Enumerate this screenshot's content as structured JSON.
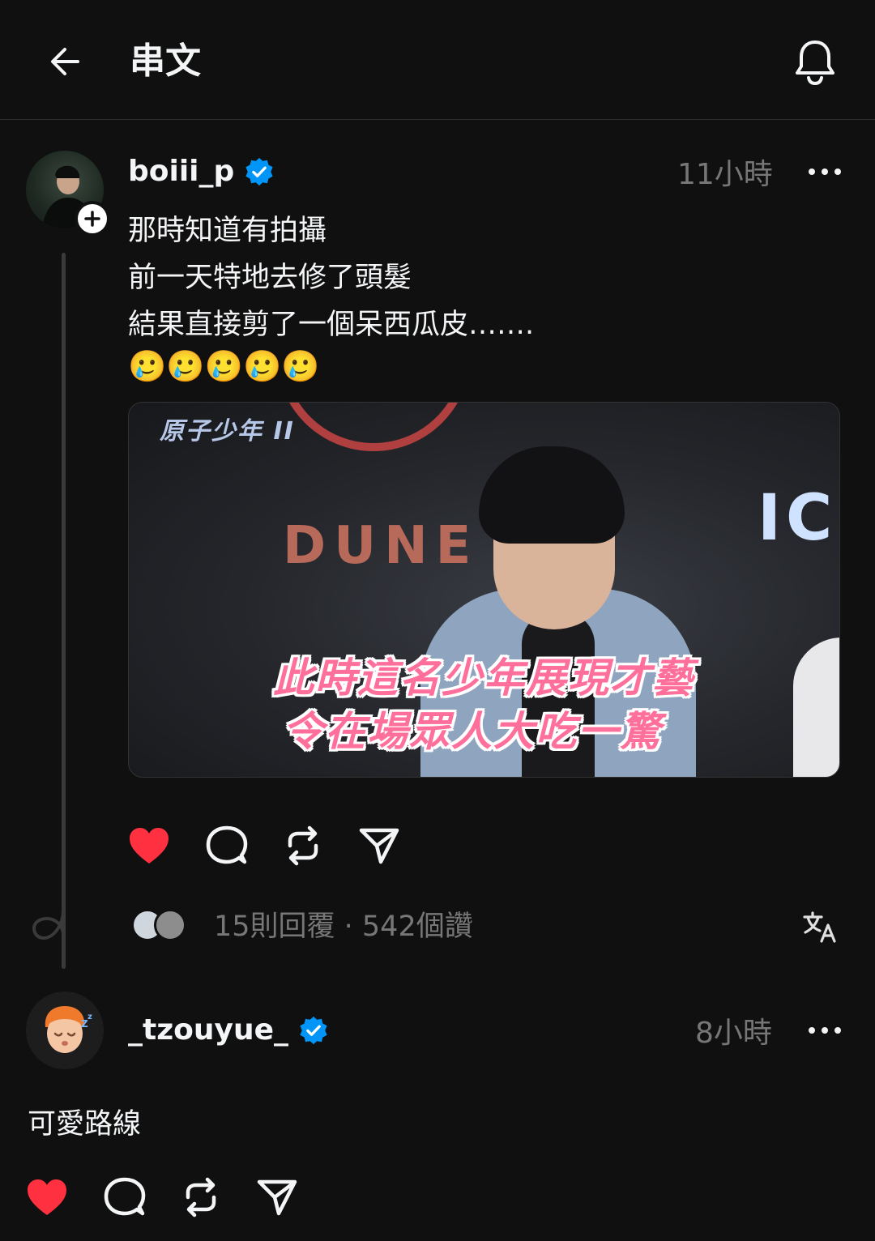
{
  "header": {
    "title": "串文"
  },
  "post": {
    "username": "boiii_p",
    "time": "11小時",
    "lines": [
      "那時知道有拍攝",
      "前一天特地去修了頭髮",
      "結果直接剪了一個呆西瓜皮……."
    ],
    "emoji": "🥲🥲🥲🥲🥲",
    "media": {
      "show_logo": "原子少年 II",
      "bg_text_left": "DUNE",
      "bg_text_right": "IC",
      "caption_line1": "此時這名少年展現才藝",
      "caption_line2": "令在場眾人大吃一驚"
    },
    "stats": "15則回覆 · 542個讚",
    "liked": true
  },
  "reply": {
    "username": "_tzouyue_",
    "time": "8小時",
    "text": "可愛路線",
    "liked": true
  },
  "colors": {
    "background": "#101010",
    "verified": "#0095f6",
    "like": "#ff3040",
    "muted": "#777777"
  }
}
